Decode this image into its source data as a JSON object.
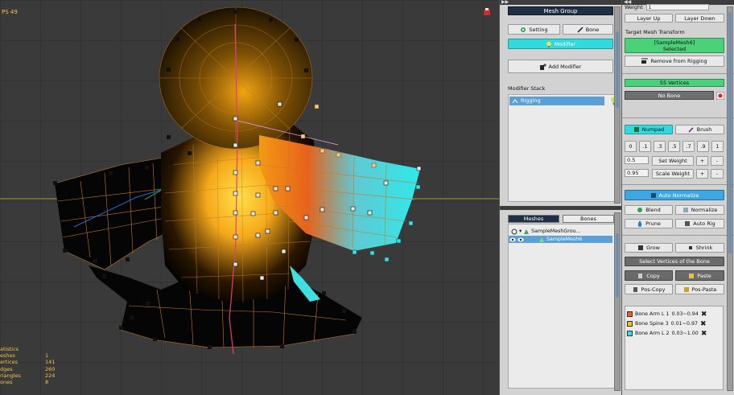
{
  "viewport": {
    "fps": "PS 49",
    "stats": {
      "title": "atistics",
      "rows": [
        {
          "label": "eshes",
          "value": "1"
        },
        {
          "label": "ertices",
          "value": "141"
        },
        {
          "label": "dges",
          "value": "260"
        },
        {
          "label": "riangles",
          "value": "224"
        },
        {
          "label": "ones",
          "value": "8"
        }
      ]
    }
  },
  "mesh_group": {
    "header": "Mesh Group",
    "setting_label": "Setting",
    "bone_label": "Bone",
    "modifier_label": "Modifier",
    "add_modifier_label": "Add Modifier",
    "modifier_stack_label": "Modifier Stack",
    "stack_items": [
      {
        "label": "Rigging"
      }
    ]
  },
  "hierarchy": {
    "tab_meshes": "Meshes",
    "tab_bones": "Bones",
    "group_name": "SampleMeshGrou...",
    "mesh_name": "SampleMesh6"
  },
  "right": {
    "weight_label": "Weight",
    "weight_value": "1",
    "layer_up": "Layer Up",
    "layer_down": "Layer Down",
    "target_label": "Target Mesh Transform",
    "selected_line1": "[SampleMesh6]",
    "selected_line2": "Selected",
    "remove_rigging": "Remove from Rigging",
    "vertices": "55 Vertices",
    "no_bone": "No Bone",
    "numpad": "Numpad",
    "brush": "Brush",
    "numpad_values": [
      "0",
      ".1",
      ".3",
      ".5",
      ".7",
      ".9",
      "1"
    ],
    "set_weight_value": "0.5",
    "set_weight_label": "Set Weight",
    "scale_weight_value": "0.95",
    "scale_weight_label": "Scale Weight",
    "plus": "+",
    "minus": "-",
    "auto_normalize": "Auto Normalize",
    "blend": "Blend",
    "normalize": "Normalize",
    "prune": "Prune",
    "auto_rig": "Auto Rig",
    "grow": "Grow",
    "shrink": "Shrink",
    "select_vertices_bone": "Select Vertices of the Bone",
    "copy": "Copy",
    "paste": "Paste",
    "pos_copy": "Pos-Copy",
    "pos_paste": "Pos-Paste",
    "bones": [
      {
        "name": "Bone Arm L 1",
        "range": "0.03~0.94",
        "color": "#e8611f"
      },
      {
        "name": "Bone Spine 3",
        "range": "0.01~0.97",
        "color": "#f5c10e"
      },
      {
        "name": "Bone Arm L 2",
        "range": "0.03~1.00",
        "color": "#2fe3e6"
      }
    ]
  },
  "colors": {
    "accent_cyan": "#32d9dd",
    "accent_green": "#4ad17a",
    "header_navy": "#1f2f45",
    "selection_blue": "#5aa0d6"
  }
}
